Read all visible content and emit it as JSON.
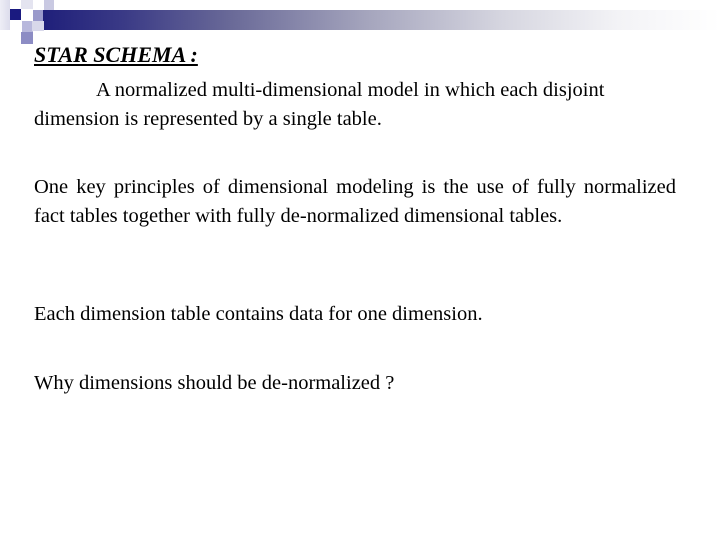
{
  "slide": {
    "title": "STAR SCHEMA :",
    "paragraphs": [
      {
        "text": "A normalized multi-dimensional model in which each disjoint dimension is represented by a single table."
      },
      {
        "text": "One key principles of dimensional modeling is the use of fully normalized fact tables together with fully de-normalized dimensional tables."
      },
      {
        "text": "Each dimension table contains data for one dimension."
      },
      {
        "text": "Why dimensions should be de-normalized ?"
      }
    ]
  },
  "theme": {
    "accent_dark": "#1a1a80",
    "accent_light": "#b8b8dc",
    "text_color": "#000000",
    "background": "#ffffff"
  },
  "decoration": {
    "logo": "blue-squares-logo",
    "header": "blue-gradient-bar"
  }
}
